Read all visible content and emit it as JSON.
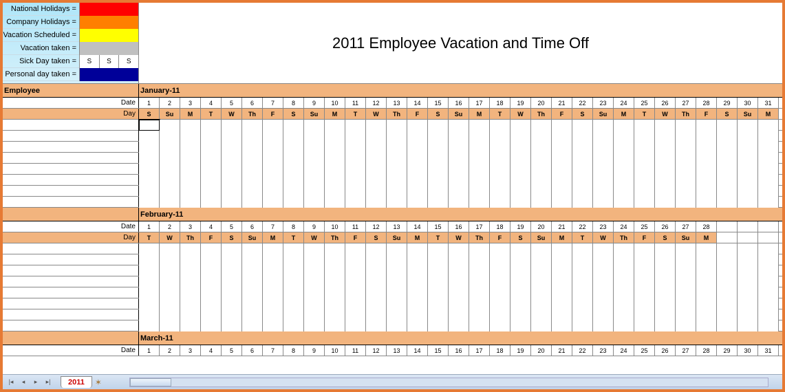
{
  "title": "2011 Employee Vacation and Time Off",
  "legend": {
    "items": [
      {
        "label": "National Holidays =",
        "color": "#ff0000"
      },
      {
        "label": "Company Holidays =",
        "color": "#ff7f00"
      },
      {
        "label": "Vacation Scheduled =",
        "color": "#ffff00"
      },
      {
        "label": "Vacation taken =",
        "color": "#c0c0c0"
      },
      {
        "label": "Sick Day taken =",
        "color": "#ffffff",
        "cells": [
          "S",
          "S",
          "S"
        ]
      },
      {
        "label": "Personal day taken =",
        "color": "#000099"
      }
    ]
  },
  "labels": {
    "employee": "Employee",
    "date": "Date",
    "day": "Day"
  },
  "months": [
    {
      "name": "January-11",
      "dates": [
        "1",
        "2",
        "3",
        "4",
        "5",
        "6",
        "7",
        "8",
        "9",
        "10",
        "11",
        "12",
        "13",
        "14",
        "15",
        "16",
        "17",
        "18",
        "19",
        "20",
        "21",
        "22",
        "23",
        "24",
        "25",
        "26",
        "27",
        "28",
        "29",
        "30",
        "31"
      ],
      "dows": [
        "S",
        "Su",
        "M",
        "T",
        "W",
        "Th",
        "F",
        "S",
        "Su",
        "M",
        "T",
        "W",
        "Th",
        "F",
        "S",
        "Su",
        "M",
        "T",
        "W",
        "Th",
        "F",
        "S",
        "Su",
        "M",
        "T",
        "W",
        "Th",
        "F",
        "S",
        "Su",
        "M"
      ],
      "empty_rows": 8
    },
    {
      "name": "February-11",
      "dates": [
        "1",
        "2",
        "3",
        "4",
        "5",
        "6",
        "7",
        "8",
        "9",
        "10",
        "11",
        "12",
        "13",
        "14",
        "15",
        "16",
        "17",
        "18",
        "19",
        "20",
        "21",
        "22",
        "23",
        "24",
        "25",
        "26",
        "27",
        "28"
      ],
      "dows": [
        "T",
        "W",
        "Th",
        "F",
        "S",
        "Su",
        "M",
        "T",
        "W",
        "Th",
        "F",
        "S",
        "Su",
        "M",
        "T",
        "W",
        "Th",
        "F",
        "S",
        "Su",
        "M",
        "T",
        "W",
        "Th",
        "F",
        "S",
        "Su",
        "M"
      ],
      "empty_rows": 8
    },
    {
      "name": "March-11",
      "dates": [
        "1",
        "2",
        "3",
        "4",
        "5",
        "6",
        "7",
        "8",
        "9",
        "10",
        "11",
        "12",
        "13",
        "14",
        "15",
        "16",
        "17",
        "18",
        "19",
        "20",
        "21",
        "22",
        "23",
        "24",
        "25",
        "26",
        "27",
        "28",
        "29",
        "30",
        "31"
      ],
      "dows": [],
      "empty_rows": 0
    }
  ],
  "tab": {
    "name": "2011"
  }
}
